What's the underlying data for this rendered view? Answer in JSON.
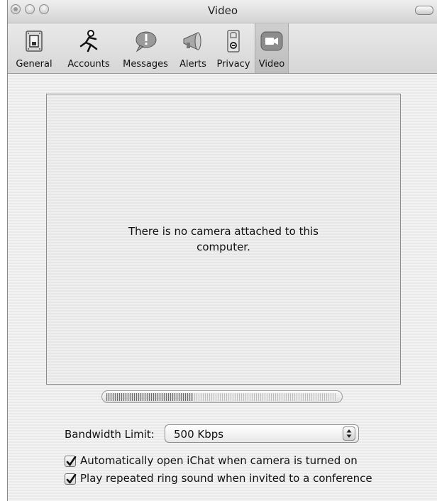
{
  "window": {
    "title": "Video"
  },
  "toolbar": {
    "items": [
      {
        "label": "General",
        "icon": "general-switch-icon",
        "selected": false
      },
      {
        "label": "Accounts",
        "icon": "running-man-icon",
        "selected": false
      },
      {
        "label": "Messages",
        "icon": "speech-bubble-icon",
        "selected": false
      },
      {
        "label": "Alerts",
        "icon": "megaphone-icon",
        "selected": false
      },
      {
        "label": "Privacy",
        "icon": "privacy-switch-icon",
        "selected": false
      },
      {
        "label": "Video",
        "icon": "video-camera-icon",
        "selected": true
      }
    ]
  },
  "preview": {
    "message": "There is no camera attached to this computer."
  },
  "microphone_level": {
    "fraction": 0.37
  },
  "bandwidth": {
    "label": "Bandwidth Limit:",
    "value": "500 Kbps"
  },
  "options": [
    {
      "label": "Automatically open iChat when camera is turned on",
      "checked": true
    },
    {
      "label": "Play repeated ring sound when invited to a conference",
      "checked": true
    }
  ]
}
